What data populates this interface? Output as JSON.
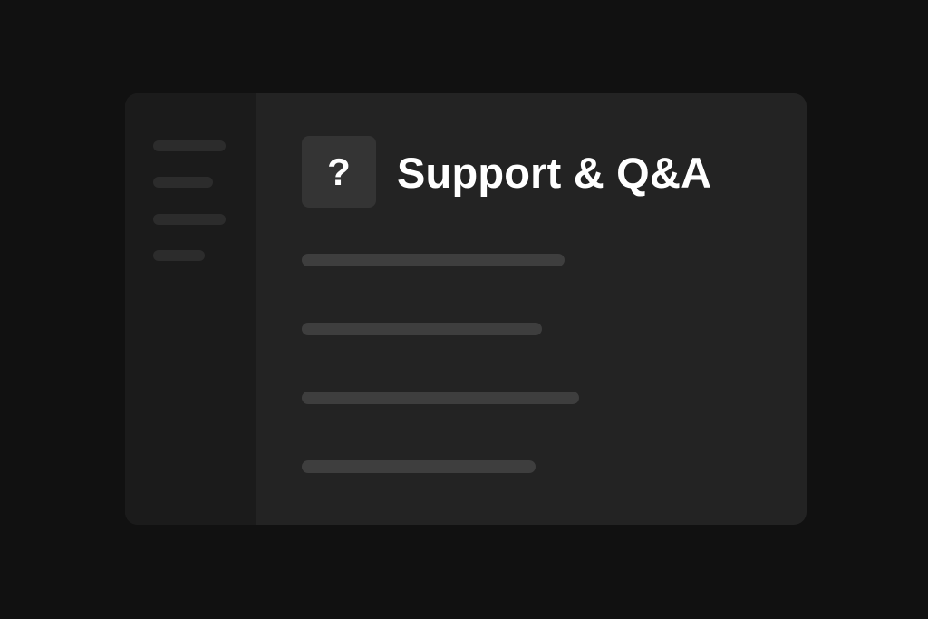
{
  "header": {
    "title": "Support & Q&A",
    "help_symbol": "?"
  },
  "sidebar": {
    "items": [
      {
        "name": "sidebar-item-1"
      },
      {
        "name": "sidebar-item-2"
      },
      {
        "name": "sidebar-item-3"
      },
      {
        "name": "sidebar-item-4"
      }
    ]
  },
  "questions": {
    "count": 4,
    "reply_icon": "chat-bubble-ellipsis-icon"
  },
  "colors": {
    "background": "#111111",
    "window": "#232323",
    "sidebar": "#1b1b1b",
    "accent": "#e8602c",
    "text": "#ffffff"
  }
}
